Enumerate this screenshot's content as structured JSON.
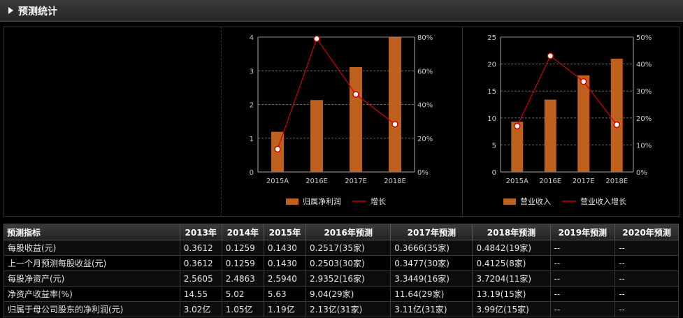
{
  "header": {
    "title": "预测统计"
  },
  "colors": {
    "bar": "#c0601f",
    "line": "#cc0000",
    "grid": "#666666",
    "text": "#cccccc"
  },
  "chart_data": [
    {
      "type": "bar",
      "categories": [
        "2015A",
        "2016E",
        "2017E",
        "2018E"
      ],
      "series": [
        {
          "name": "归属净利润",
          "type": "bar",
          "axis": "left",
          "values": [
            1.19,
            2.13,
            3.11,
            3.99
          ]
        },
        {
          "name": "增长",
          "type": "line",
          "axis": "right",
          "values": [
            13.5,
            79.0,
            46.0,
            28.3
          ]
        }
      ],
      "yleft": {
        "min": 0,
        "max": 4,
        "ticks": [
          "0",
          "1",
          "2",
          "3",
          "4"
        ]
      },
      "yright": {
        "min": 0,
        "max": 80,
        "ticks": [
          "0%",
          "20%",
          "40%",
          "60%",
          "80%"
        ]
      },
      "grid": true,
      "legend": "bottom"
    },
    {
      "type": "bar",
      "categories": [
        "2015A",
        "2016E",
        "2017E",
        "2018E"
      ],
      "series": [
        {
          "name": "营业收入",
          "type": "bar",
          "axis": "left",
          "values": [
            9.3,
            13.4,
            17.9,
            21.0
          ]
        },
        {
          "name": "营业收入增长",
          "type": "line",
          "axis": "right",
          "values": [
            17.0,
            43.0,
            33.5,
            17.5
          ]
        }
      ],
      "yleft": {
        "min": 0,
        "max": 25,
        "ticks": [
          "0",
          "5",
          "10",
          "15",
          "20",
          "25"
        ]
      },
      "yright": {
        "min": 0,
        "max": 50,
        "ticks": [
          "0%",
          "10%",
          "20%",
          "30%",
          "40%",
          "50%"
        ]
      },
      "grid": true,
      "legend": "bottom"
    }
  ],
  "table": {
    "headers": [
      "预测指标",
      "2013年",
      "2014年",
      "2015年",
      "2016年预测",
      "2017年预测",
      "2018年预测",
      "2019年预测",
      "2020年预测"
    ],
    "rows": [
      [
        "每股收益(元)",
        "0.3612",
        "0.1259",
        "0.1430",
        "0.2517(35家)",
        "0.3666(35家)",
        "0.4842(19家)",
        "--",
        "--"
      ],
      [
        "上一个月预测每股收益(元)",
        "0.3612",
        "0.1259",
        "0.1430",
        "0.2503(30家)",
        "0.3477(30家)",
        "0.4125(8家)",
        "--",
        "--"
      ],
      [
        "每股净资产(元)",
        "2.5605",
        "2.4863",
        "2.5940",
        "2.9352(16家)",
        "3.3449(16家)",
        "3.7204(11家)",
        "--",
        "--"
      ],
      [
        "净资产收益率(%)",
        "14.55",
        "5.02",
        "5.63",
        "9.04(29家)",
        "11.64(29家)",
        "13.19(15家)",
        "--",
        "--"
      ],
      [
        "归属于母公司股东的净利润(元)",
        "3.02亿",
        "1.05亿",
        "1.19亿",
        "2.13亿(31家)",
        "3.11亿(31家)",
        "3.99亿(15家)",
        "--",
        "--"
      ]
    ]
  }
}
